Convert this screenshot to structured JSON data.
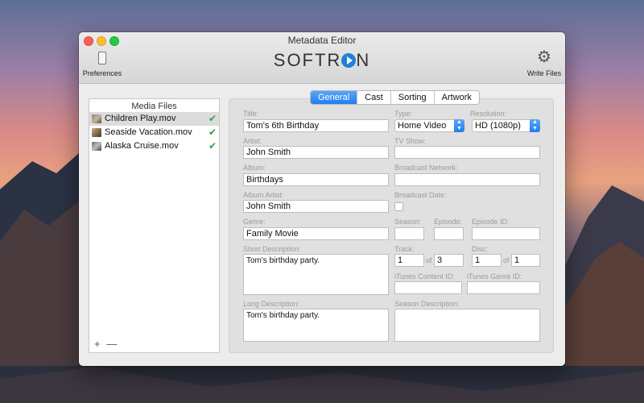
{
  "window": {
    "title": "Metadata Editor",
    "logo_pre": "SOFTR",
    "logo_post": "N"
  },
  "toolbar": {
    "preferences_label": "Preferences",
    "write_files_label": "Write Files"
  },
  "sidebar": {
    "header": "Media Files",
    "files": [
      {
        "name": "Children Play.mov",
        "checked": true,
        "selected": true
      },
      {
        "name": "Seaside Vacation.mov",
        "checked": true,
        "selected": false
      },
      {
        "name": "Alaska Cruise.mov",
        "checked": true,
        "selected": false
      }
    ],
    "add_label": "+",
    "remove_label": "—"
  },
  "tabs": [
    "General",
    "Cast",
    "Sorting",
    "Artwork"
  ],
  "active_tab": "General",
  "form": {
    "title_label": "Title:",
    "title_value": "Tom's 6th Birthday",
    "artist_label": "Artist:",
    "artist_value": "John Smith",
    "album_label": "Album:",
    "album_value": "Birthdays",
    "album_artist_label": "Album Artist:",
    "album_artist_value": "John Smith",
    "genre_label": "Genre:",
    "genre_value": "Family Movie",
    "short_desc_label": "Short Description:",
    "short_desc_value": "Tom's birthday party.",
    "long_desc_label": "Long Description:",
    "long_desc_value": "Tom's birthday party.",
    "type_label": "Type:",
    "type_value": "Home Video",
    "resolution_label": "Resolution:",
    "resolution_value": "HD (1080p)",
    "tv_show_label": "TV Show:",
    "tv_show_value": "",
    "broadcast_network_label": "Broadcast Network:",
    "broadcast_network_value": "",
    "broadcast_date_label": "Broadcast Date:",
    "season_label": "Season:",
    "season_value": "",
    "episode_label": "Episode:",
    "episode_value": "",
    "episode_id_label": "Episode ID:",
    "episode_id_value": "",
    "track_label": "Track:",
    "track_value": "1",
    "track_total": "3",
    "disc_label": "Disc:",
    "disc_value": "1",
    "disc_total": "1",
    "of_label": "of",
    "itunes_content_id_label": "iTunes Content ID:",
    "itunes_content_id_value": "",
    "itunes_genre_id_label": "iTunes Genre ID:",
    "itunes_genre_id_value": "",
    "season_desc_label": "Season Description:",
    "season_desc_value": ""
  },
  "colors": {
    "accent": "#1f7ef2",
    "check": "#2da14a"
  }
}
